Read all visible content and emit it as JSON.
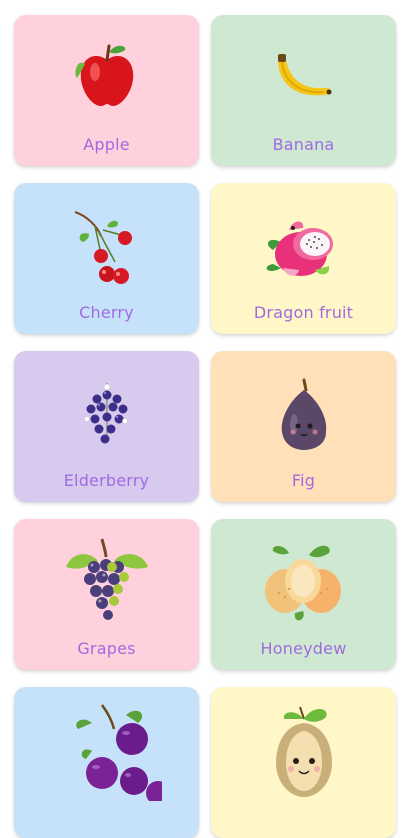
{
  "cards": [
    {
      "label": "Apple",
      "bg": "#ffd1dc",
      "icon": "apple-icon"
    },
    {
      "label": "Banana",
      "bg": "#cfe8d2",
      "icon": "banana-icon"
    },
    {
      "label": "Cherry",
      "bg": "#c6e2fb",
      "icon": "cherry-icon"
    },
    {
      "label": "Dragon fruit",
      "bg": "#fff7c8",
      "icon": "dragon-fruit-icon"
    },
    {
      "label": "Elderberry",
      "bg": "#d8c9ee",
      "icon": "elderberry-icon"
    },
    {
      "label": "Fig",
      "bg": "#ffe0b8",
      "icon": "fig-icon"
    },
    {
      "label": "Grapes",
      "bg": "#ffd1dc",
      "icon": "grapes-icon"
    },
    {
      "label": "Honeydew",
      "bg": "#cfe8d2",
      "icon": "honeydew-icon"
    },
    {
      "label": "",
      "bg": "#c6e2fb",
      "icon": "mangosteen-icon"
    },
    {
      "label": "",
      "bg": "#fff7c8",
      "icon": "jackfruit-icon"
    }
  ],
  "colors": {
    "label_text": "#a06be0"
  }
}
